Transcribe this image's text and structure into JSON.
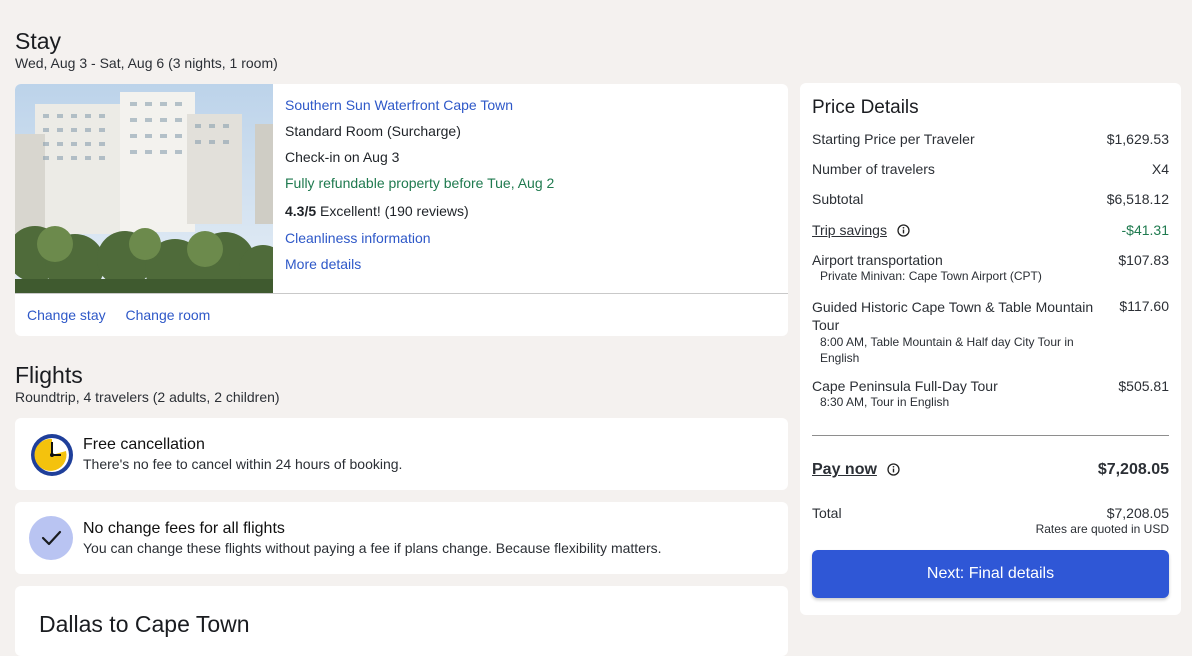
{
  "stay": {
    "title": "Stay",
    "dates": "Wed, Aug 3 - Sat, Aug 6 (3 nights, 1 room)",
    "hotel": {
      "name": "Southern Sun Waterfront Cape Town",
      "room": "Standard Room (Surcharge)",
      "checkin": "Check-in on Aug 3",
      "refund": "Fully refundable property before Tue, Aug 2",
      "rating": "4.3/5",
      "rating_text": "Excellent! (190 reviews)",
      "cleanliness": "Cleanliness information",
      "more": "More details"
    },
    "actions": {
      "change_stay": "Change stay",
      "change_room": "Change room"
    }
  },
  "flights": {
    "title": "Flights",
    "subtitle": "Roundtrip, 4 travelers (2 adults, 2 children)",
    "free_cancel": {
      "title": "Free cancellation",
      "text": "There's no fee to cancel within 24 hours of booking."
    },
    "no_change": {
      "title": "No change fees for all flights",
      "text": "You can change these flights without paying a fee if plans change. Because flexibility matters."
    },
    "route": "Dallas to Cape Town"
  },
  "price": {
    "title": "Price Details",
    "rows": [
      {
        "label": "Starting Price per Traveler",
        "value": "$1,629.53"
      },
      {
        "label": "Number of travelers",
        "value": "X4"
      },
      {
        "label": "Subtotal",
        "value": "$6,518.12"
      },
      {
        "label": "Trip savings",
        "value": "-$41.31"
      },
      {
        "label": "Airport transportation",
        "value": "$107.83",
        "note": "Private Minivan: Cape Town Airport (CPT)"
      },
      {
        "label": "Guided Historic Cape Town & Table Mountain Tour",
        "value": "$117.60",
        "note": "8:00 AM, Table Mountain & Half day City Tour in English"
      },
      {
        "label": "Cape Peninsula Full-Day Tour",
        "value": "$505.81",
        "note": "8:30 AM, Tour in English"
      }
    ],
    "pay_now_label": "Pay now",
    "pay_now_value": "$7,208.05",
    "total_label": "Total",
    "total_value": "$7,208.05",
    "currency_note": "Rates are quoted in USD",
    "next_button": "Next: Final details"
  },
  "colors": {
    "accent": "#2f57d6",
    "link": "#2e58c8",
    "savings": "#1f7a4f",
    "background": "#f4f1ef"
  }
}
